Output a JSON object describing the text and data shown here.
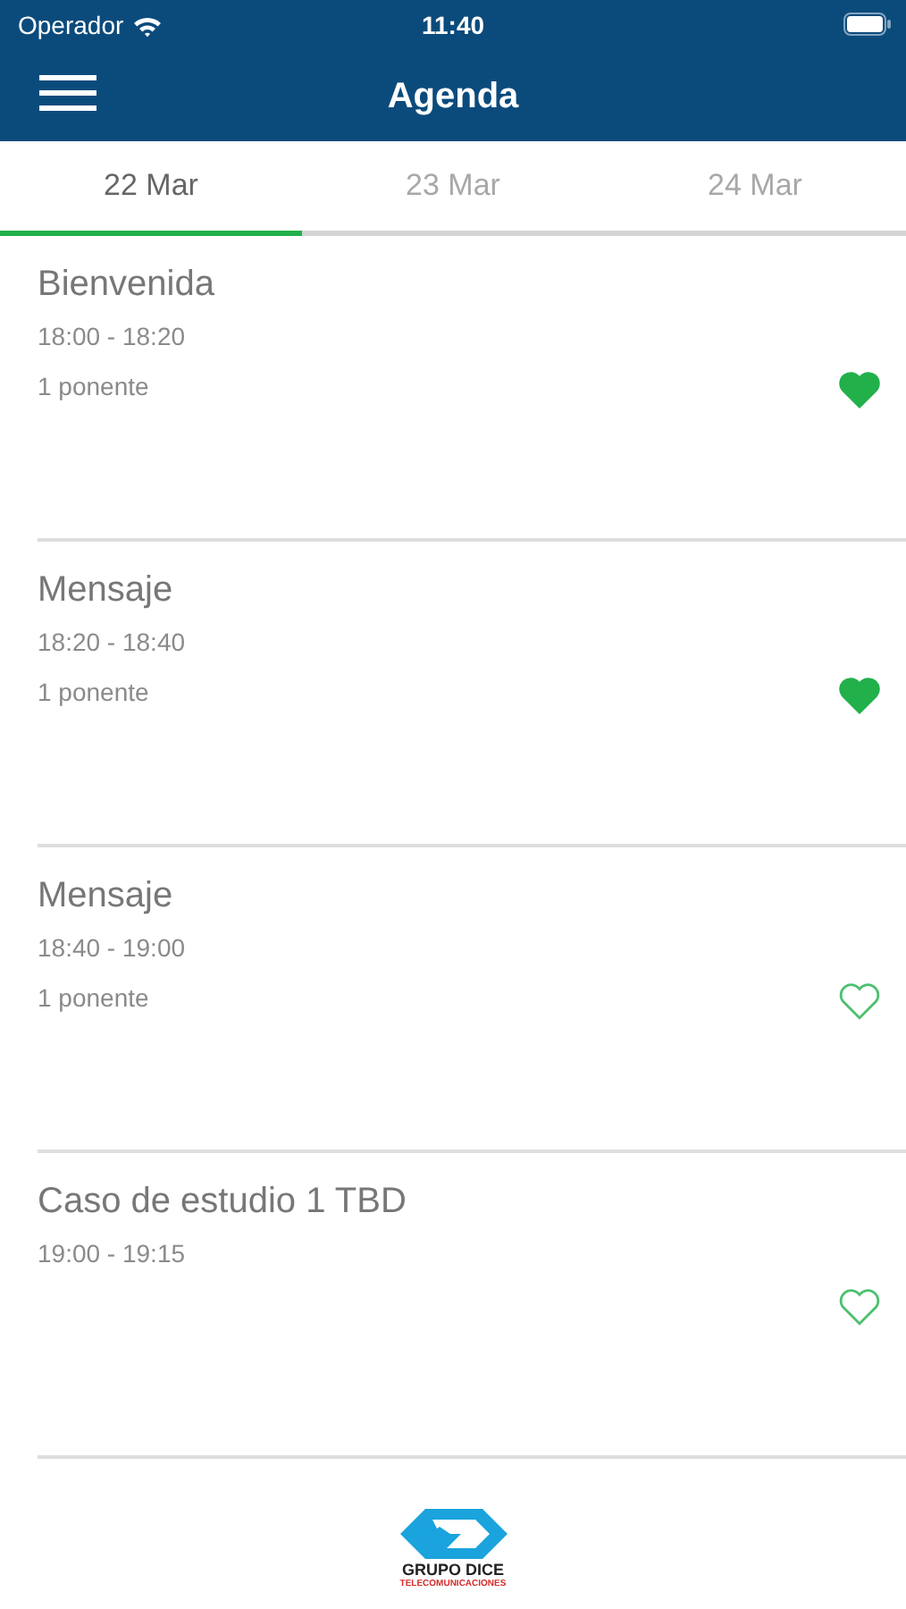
{
  "status_bar": {
    "carrier": "Operador",
    "time": "11:40"
  },
  "header": {
    "title": "Agenda"
  },
  "tabs": [
    {
      "label": "22 Mar",
      "selected": true
    },
    {
      "label": "23 Mar",
      "selected": false
    },
    {
      "label": "24 Mar",
      "selected": false
    }
  ],
  "sessions": [
    {
      "title": "Bienvenida",
      "time": "18:00 - 18:20",
      "speakers": "1 ponente",
      "favorite": true
    },
    {
      "title": "Mensaje",
      "time": "18:20 - 18:40",
      "speakers": "1 ponente",
      "favorite": true
    },
    {
      "title": "Mensaje",
      "time": "18:40 - 19:00",
      "speakers": "1 ponente",
      "favorite": false
    },
    {
      "title": "Caso de estudio 1 TBD",
      "time": "19:00 - 19:15",
      "favorite": false
    }
  ],
  "footer": {
    "logo_name": "GRUPO DICE",
    "logo_tagline": "TELECOMUNICACIONES"
  }
}
